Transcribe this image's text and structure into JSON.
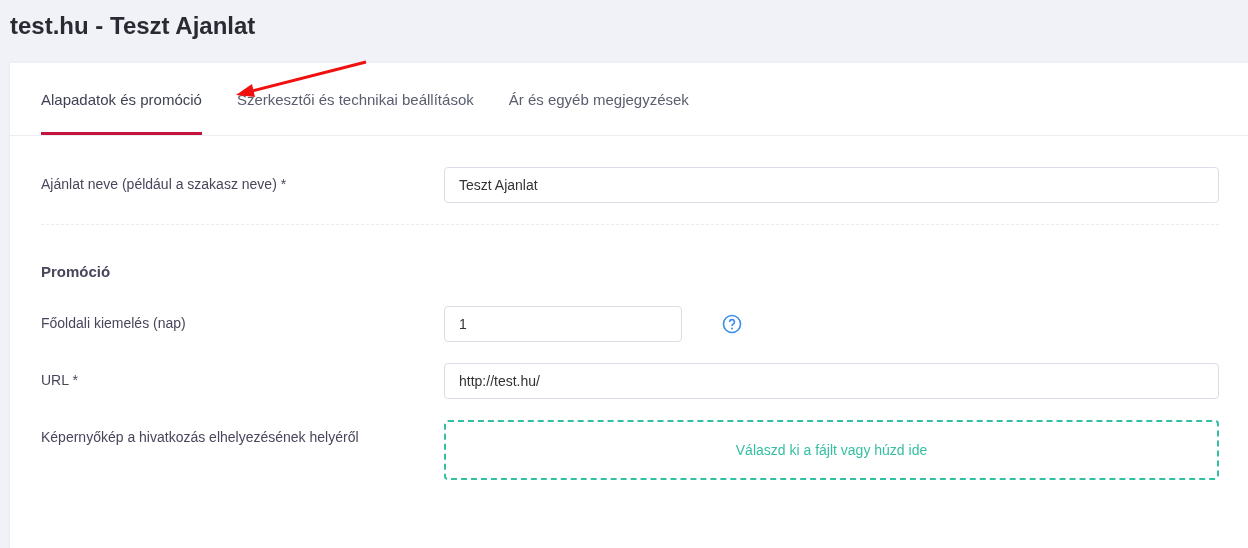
{
  "page_title": "test.hu - Teszt Ajanlat",
  "tabs": [
    {
      "label": "Alapadatok és promóció",
      "selected": true
    },
    {
      "label": "Szerkesztői és technikai beállítások",
      "selected": false
    },
    {
      "label": "Ár és egyéb megjegyzések",
      "selected": false
    }
  ],
  "fields": [
    {
      "kind": "text",
      "label": "Ajánlat neve (például a szakasz neve) *",
      "value": "Teszt Ajanlat"
    }
  ],
  "promotion": {
    "heading": "Promóció",
    "fields": [
      {
        "kind": "short",
        "label": "Főoldali kiemelés (nap)",
        "value": "1",
        "help": true
      },
      {
        "kind": "text",
        "label": "URL *",
        "value": "http://test.hu/"
      },
      {
        "kind": "dropzone",
        "label": "Képernyőkép a hivatkozás elhelyezésének helyéről",
        "placeholder": "Válaszd ki a fájlt vagy húzd ide"
      }
    ]
  }
}
